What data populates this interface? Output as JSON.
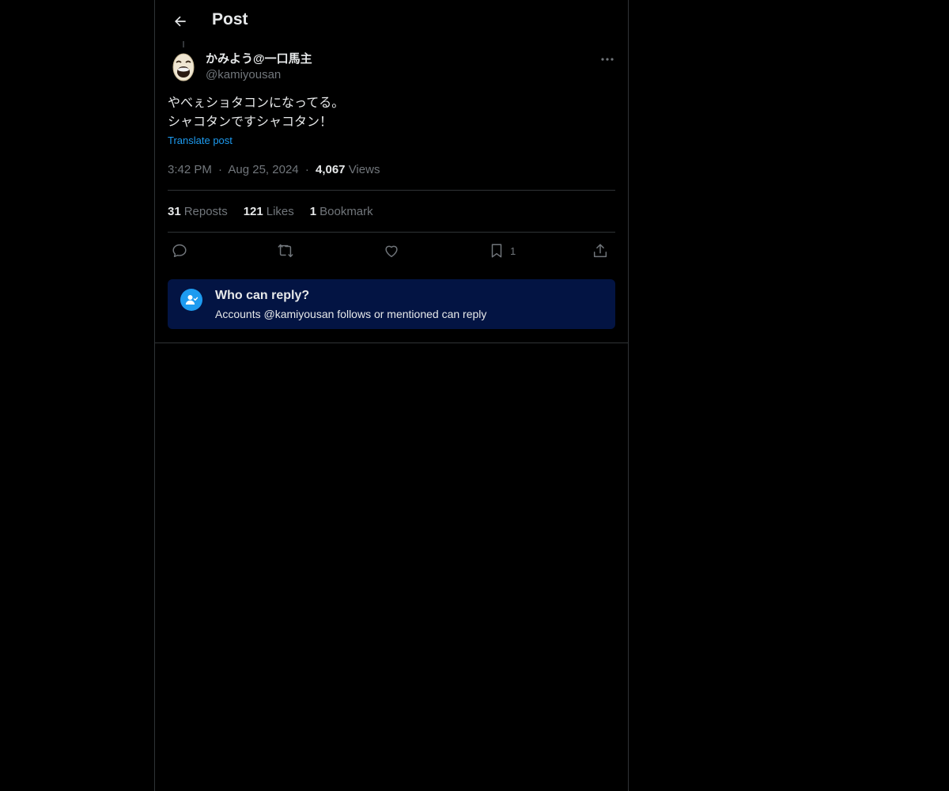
{
  "header": {
    "title": "Post"
  },
  "post": {
    "author": {
      "display_name": "かみよう@一口馬主",
      "handle": "@kamiyousan"
    },
    "text": "やべぇショタコンになってる。\nシャコタンですシャコタン！",
    "translate_label": "Translate post",
    "time": "3:42 PM",
    "date": "Aug 25, 2024",
    "separator": "·",
    "views_count": "4,067",
    "views_label": "Views"
  },
  "stats": {
    "reposts_count": "31",
    "reposts_label": "Reposts",
    "likes_count": "121",
    "likes_label": "Likes",
    "bookmarks_count": "1",
    "bookmarks_label": "Bookmark"
  },
  "actions": {
    "bookmark_count": "1"
  },
  "reply_restriction": {
    "title": "Who can reply?",
    "description": "Accounts @kamiyousan follows or mentioned can reply"
  },
  "colors": {
    "background": "#000000",
    "accent": "#1d9bf0",
    "reply_box": "#031443",
    "muted": "#71767b"
  },
  "icons": {
    "back": "arrow-left-icon",
    "more": "more-horizontal-icon",
    "reply": "speech-bubble-icon",
    "repost": "repost-icon",
    "like": "heart-icon",
    "bookmark": "bookmark-icon",
    "share": "share-icon",
    "reply_restriction": "person-check-icon"
  }
}
